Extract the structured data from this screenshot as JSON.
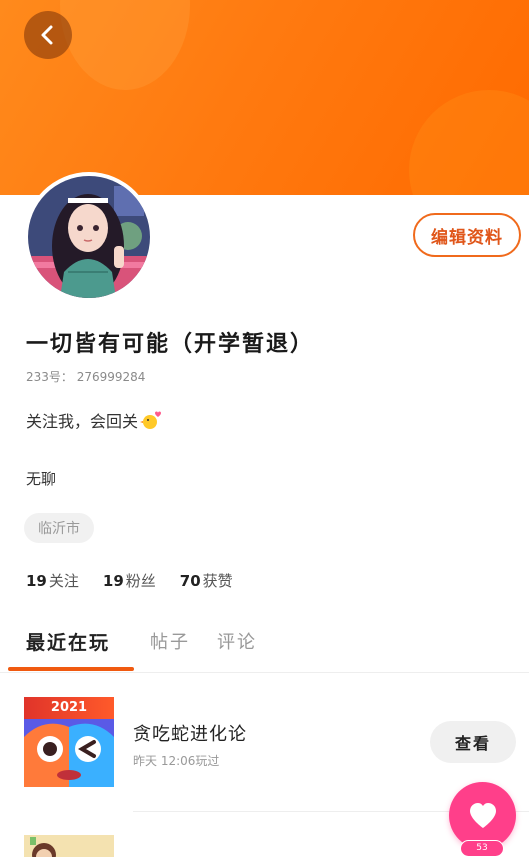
{
  "header": {
    "back_icon": "chevron-left-icon"
  },
  "profile": {
    "edit_label": "编辑资料",
    "username": "一切皆有可能（开学暂退）",
    "user_id": "233号： 276999284",
    "bio_text": "关注我，会回关",
    "bio_emoji": "chick-heart-icon",
    "signature": "无聊",
    "location": "临沂市"
  },
  "stats": {
    "following_count": "19",
    "following_label": "关注",
    "followers_count": "19",
    "followers_label": "粉丝",
    "likes_count": "70",
    "likes_label": "获赞"
  },
  "tabs": [
    {
      "label": "最近在玩",
      "active": true
    },
    {
      "label": "帖子",
      "active": false
    },
    {
      "label": "评论",
      "active": false
    }
  ],
  "recent_games": [
    {
      "year": "2021",
      "title": "贪吃蛇进化论",
      "played": "昨天 12:06玩过",
      "action": "查看"
    }
  ],
  "fab": {
    "icon": "heart-icon",
    "count": "53"
  },
  "colors": {
    "accent": "#f05a10",
    "banner": "#ff7a10",
    "fab": "#ff3f8a"
  }
}
